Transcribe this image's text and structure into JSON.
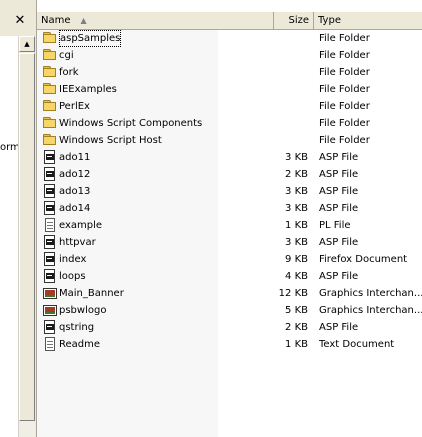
{
  "left_pane": {
    "close_symbol": "✕",
    "truncated_text": "orm",
    "scroll_up_symbol": "▲"
  },
  "columns": {
    "name": "Name",
    "size": "Size",
    "type": "Type",
    "sort_indicator": "▲"
  },
  "files": [
    {
      "name": "aspSamples",
      "size": "",
      "type": "File Folder",
      "icon": "folder-icon"
    },
    {
      "name": "cgi",
      "size": "",
      "type": "File Folder",
      "icon": "folder-icon"
    },
    {
      "name": "fork",
      "size": "",
      "type": "File Folder",
      "icon": "folder-icon"
    },
    {
      "name": "IEExamples",
      "size": "",
      "type": "File Folder",
      "icon": "folder-icon"
    },
    {
      "name": "PerlEx",
      "size": "",
      "type": "File Folder",
      "icon": "folder-icon"
    },
    {
      "name": "Windows Script Components",
      "size": "",
      "type": "File Folder",
      "icon": "folder-icon"
    },
    {
      "name": "Windows Script Host",
      "size": "",
      "type": "File Folder",
      "icon": "folder-icon"
    },
    {
      "name": "ado11",
      "size": "3 KB",
      "type": "ASP File",
      "icon": "asp-file-icon"
    },
    {
      "name": "ado12",
      "size": "2 KB",
      "type": "ASP File",
      "icon": "asp-file-icon"
    },
    {
      "name": "ado13",
      "size": "3 KB",
      "type": "ASP File",
      "icon": "asp-file-icon"
    },
    {
      "name": "ado14",
      "size": "3 KB",
      "type": "ASP File",
      "icon": "asp-file-icon"
    },
    {
      "name": "example",
      "size": "1 KB",
      "type": "PL File",
      "icon": "text-file-icon"
    },
    {
      "name": "httpvar",
      "size": "3 KB",
      "type": "ASP File",
      "icon": "asp-file-icon"
    },
    {
      "name": "index",
      "size": "9 KB",
      "type": "Firefox Document",
      "icon": "asp-file-icon"
    },
    {
      "name": "loops",
      "size": "4 KB",
      "type": "ASP File",
      "icon": "asp-file-icon"
    },
    {
      "name": "Main_Banner",
      "size": "12 KB",
      "type": "Graphics Interchan...",
      "icon": "image-file-icon"
    },
    {
      "name": "psbwlogo",
      "size": "5 KB",
      "type": "Graphics Interchan...",
      "icon": "image-file-icon"
    },
    {
      "name": "qstring",
      "size": "2 KB",
      "type": "ASP File",
      "icon": "asp-file-icon"
    },
    {
      "name": "Readme",
      "size": "1 KB",
      "type": "Text Document",
      "icon": "text-file-icon"
    }
  ]
}
